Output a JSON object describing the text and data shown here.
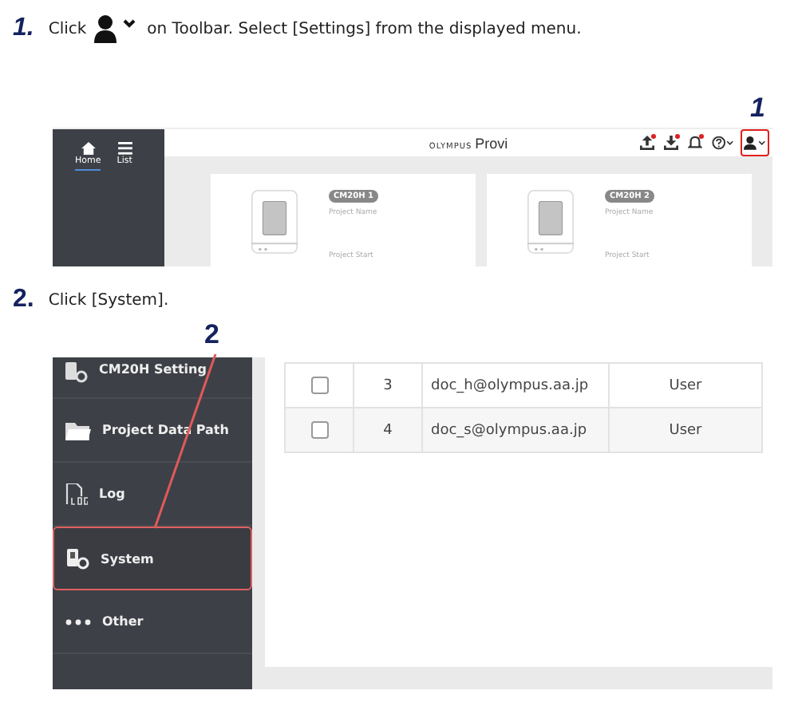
{
  "step_1": {
    "number": "1.",
    "text_before": "Click",
    "text_after": "on Toolbar. Select [Settings] from the displayed menu."
  },
  "screenshot_1": {
    "callout": "1",
    "sidebar": [
      {
        "label": "Home",
        "kind": "home",
        "selected": true
      },
      {
        "label": "List",
        "kind": "list",
        "selected": false
      }
    ],
    "logo": "OLYMPUS",
    "product": "Provi",
    "toolbar": [
      {
        "kind": "upload",
        "badge": true,
        "highlighted": false
      },
      {
        "kind": "download",
        "badge": true,
        "highlighted": false
      },
      {
        "kind": "bell",
        "badge": true,
        "highlighted": false
      },
      {
        "kind": "help",
        "badge": false,
        "highlighted": false
      },
      {
        "kind": "user",
        "badge": false,
        "highlighted": true
      }
    ],
    "cards": [
      {
        "tag": "CM20H 1",
        "name_label": "Project Name",
        "start_label": "Project Start"
      },
      {
        "tag": "CM20H 2",
        "name_label": "Project Name",
        "start_label": "Project Start"
      }
    ]
  },
  "step_2": {
    "number": "2.",
    "text": "Click [System]."
  },
  "screenshot_2": {
    "callout": "2",
    "menu": [
      {
        "label": "CM20H Setting",
        "kind": "device-settings",
        "highlighted": false
      },
      {
        "label": "Project Data Path",
        "kind": "folder",
        "highlighted": false
      },
      {
        "label": "Log",
        "kind": "log",
        "highlighted": false
      },
      {
        "label": "System",
        "kind": "system",
        "highlighted": true
      },
      {
        "label": "Other",
        "kind": "dots",
        "highlighted": false
      }
    ],
    "rows": [
      {
        "checked": false,
        "number": "3",
        "email": "doc_h@olympus.aa.jp",
        "role": "User"
      },
      {
        "checked": false,
        "number": "4",
        "email": "doc_s@olympus.aa.jp",
        "role": "User"
      }
    ]
  }
}
